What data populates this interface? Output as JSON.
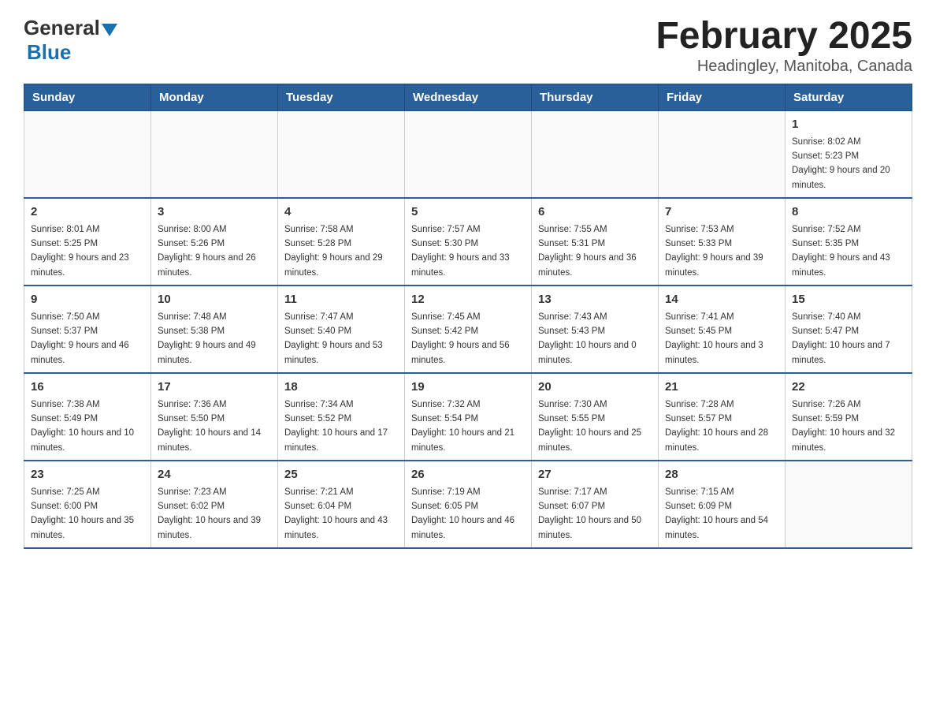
{
  "logo": {
    "part1": "General",
    "part2": "Blue"
  },
  "title": "February 2025",
  "subtitle": "Headingley, Manitoba, Canada",
  "weekdays": [
    "Sunday",
    "Monday",
    "Tuesday",
    "Wednesday",
    "Thursday",
    "Friday",
    "Saturday"
  ],
  "weeks": [
    [
      {
        "day": "",
        "info": ""
      },
      {
        "day": "",
        "info": ""
      },
      {
        "day": "",
        "info": ""
      },
      {
        "day": "",
        "info": ""
      },
      {
        "day": "",
        "info": ""
      },
      {
        "day": "",
        "info": ""
      },
      {
        "day": "1",
        "info": "Sunrise: 8:02 AM\nSunset: 5:23 PM\nDaylight: 9 hours and 20 minutes."
      }
    ],
    [
      {
        "day": "2",
        "info": "Sunrise: 8:01 AM\nSunset: 5:25 PM\nDaylight: 9 hours and 23 minutes."
      },
      {
        "day": "3",
        "info": "Sunrise: 8:00 AM\nSunset: 5:26 PM\nDaylight: 9 hours and 26 minutes."
      },
      {
        "day": "4",
        "info": "Sunrise: 7:58 AM\nSunset: 5:28 PM\nDaylight: 9 hours and 29 minutes."
      },
      {
        "day": "5",
        "info": "Sunrise: 7:57 AM\nSunset: 5:30 PM\nDaylight: 9 hours and 33 minutes."
      },
      {
        "day": "6",
        "info": "Sunrise: 7:55 AM\nSunset: 5:31 PM\nDaylight: 9 hours and 36 minutes."
      },
      {
        "day": "7",
        "info": "Sunrise: 7:53 AM\nSunset: 5:33 PM\nDaylight: 9 hours and 39 minutes."
      },
      {
        "day": "8",
        "info": "Sunrise: 7:52 AM\nSunset: 5:35 PM\nDaylight: 9 hours and 43 minutes."
      }
    ],
    [
      {
        "day": "9",
        "info": "Sunrise: 7:50 AM\nSunset: 5:37 PM\nDaylight: 9 hours and 46 minutes."
      },
      {
        "day": "10",
        "info": "Sunrise: 7:48 AM\nSunset: 5:38 PM\nDaylight: 9 hours and 49 minutes."
      },
      {
        "day": "11",
        "info": "Sunrise: 7:47 AM\nSunset: 5:40 PM\nDaylight: 9 hours and 53 minutes."
      },
      {
        "day": "12",
        "info": "Sunrise: 7:45 AM\nSunset: 5:42 PM\nDaylight: 9 hours and 56 minutes."
      },
      {
        "day": "13",
        "info": "Sunrise: 7:43 AM\nSunset: 5:43 PM\nDaylight: 10 hours and 0 minutes."
      },
      {
        "day": "14",
        "info": "Sunrise: 7:41 AM\nSunset: 5:45 PM\nDaylight: 10 hours and 3 minutes."
      },
      {
        "day": "15",
        "info": "Sunrise: 7:40 AM\nSunset: 5:47 PM\nDaylight: 10 hours and 7 minutes."
      }
    ],
    [
      {
        "day": "16",
        "info": "Sunrise: 7:38 AM\nSunset: 5:49 PM\nDaylight: 10 hours and 10 minutes."
      },
      {
        "day": "17",
        "info": "Sunrise: 7:36 AM\nSunset: 5:50 PM\nDaylight: 10 hours and 14 minutes."
      },
      {
        "day": "18",
        "info": "Sunrise: 7:34 AM\nSunset: 5:52 PM\nDaylight: 10 hours and 17 minutes."
      },
      {
        "day": "19",
        "info": "Sunrise: 7:32 AM\nSunset: 5:54 PM\nDaylight: 10 hours and 21 minutes."
      },
      {
        "day": "20",
        "info": "Sunrise: 7:30 AM\nSunset: 5:55 PM\nDaylight: 10 hours and 25 minutes."
      },
      {
        "day": "21",
        "info": "Sunrise: 7:28 AM\nSunset: 5:57 PM\nDaylight: 10 hours and 28 minutes."
      },
      {
        "day": "22",
        "info": "Sunrise: 7:26 AM\nSunset: 5:59 PM\nDaylight: 10 hours and 32 minutes."
      }
    ],
    [
      {
        "day": "23",
        "info": "Sunrise: 7:25 AM\nSunset: 6:00 PM\nDaylight: 10 hours and 35 minutes."
      },
      {
        "day": "24",
        "info": "Sunrise: 7:23 AM\nSunset: 6:02 PM\nDaylight: 10 hours and 39 minutes."
      },
      {
        "day": "25",
        "info": "Sunrise: 7:21 AM\nSunset: 6:04 PM\nDaylight: 10 hours and 43 minutes."
      },
      {
        "day": "26",
        "info": "Sunrise: 7:19 AM\nSunset: 6:05 PM\nDaylight: 10 hours and 46 minutes."
      },
      {
        "day": "27",
        "info": "Sunrise: 7:17 AM\nSunset: 6:07 PM\nDaylight: 10 hours and 50 minutes."
      },
      {
        "day": "28",
        "info": "Sunrise: 7:15 AM\nSunset: 6:09 PM\nDaylight: 10 hours and 54 minutes."
      },
      {
        "day": "",
        "info": ""
      }
    ]
  ]
}
